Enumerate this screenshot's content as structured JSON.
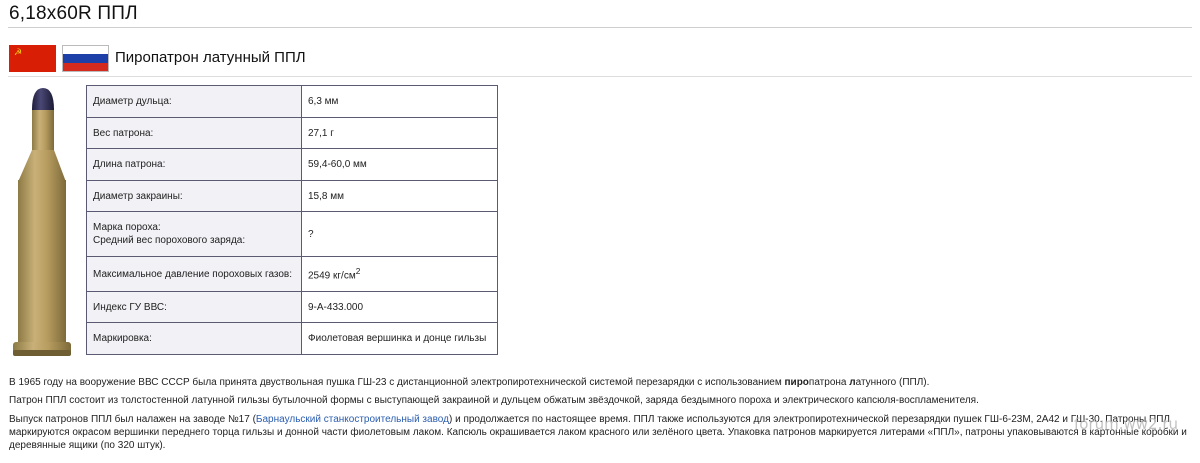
{
  "page": {
    "title": "6,18x60R ППЛ",
    "subtitle": "Пиропатрон латунный ППЛ"
  },
  "flags": [
    {
      "name": "ussr-flag",
      "colors": [
        "#d81e05",
        "#f5d20f"
      ]
    },
    {
      "name": "russia-flag",
      "colors": [
        "#ffffff",
        "#1c3fa8",
        "#d52b1e"
      ]
    }
  ],
  "specs": [
    {
      "label": "Диаметр дульца:",
      "value": "6,3 мм"
    },
    {
      "label": "Вес патрона:",
      "value": "27,1 г"
    },
    {
      "label": "Длина патрона:",
      "value": "59,4-60,0 мм"
    },
    {
      "label": "Диаметр закраины:",
      "value": "15,8 мм"
    },
    {
      "label": "Марка пороха:",
      "label2": "Средний вес порохового заряда:",
      "value": "?"
    },
    {
      "label": "Максимальное давление пороховых газов:",
      "value": "2549 кг/см",
      "value_sup": "2"
    },
    {
      "label": "Индекс ГУ ВВС:",
      "value": "9-А-433.000"
    },
    {
      "label": "Маркировка:",
      "value": "Фиолетовая вершинка и донце гильзы"
    }
  ],
  "paragraphs": {
    "p1": {
      "a": "В 1965 году на вооружение ВВС СССР была принята двуствольная пушка ГШ-23 с дистанционной электропиротехнической системой перезарядки с использованием ",
      "b1": "пиро",
      "c": "патрона ",
      "b2": "л",
      "d": "атунного (ППЛ)."
    },
    "p2": "Патрон ППЛ состоит из толстостенной латунной гильзы бутылочной формы с выступающей закраиной и дульцем обжатым звёздочкой, заряда бездымного пороха и электрического капсюля-воспламенителя.",
    "p3": {
      "a": "Выпуск патронов ППЛ был налажен на заводе №17 (",
      "link": "Барнаульский станкостроительный завод",
      "b": ") и продолжается по настоящее время. ППЛ также используются для электропиротехнической перезарядки пушек ГШ-6-23М, 2А42 и ГШ-30. Патроны ППЛ маркируются окрасом вершинки переднего торца гильзы и донной части фиолетовым лаком. Капсюль окрашивается лаком красного или зелёного цвета. Упаковка патронов маркируется литерами «ППЛ», патроны упаковываются в картонные коробки и деревянные ящики (по 320 штук)."
    }
  },
  "watermark": "forum.ww2.ru",
  "colors": {
    "link": "#2a5db0",
    "table_border": "#5a5a72",
    "label_bg": "#f1f1f6",
    "brass": "#b59a5a",
    "tip_violet": "#2c2a52"
  }
}
